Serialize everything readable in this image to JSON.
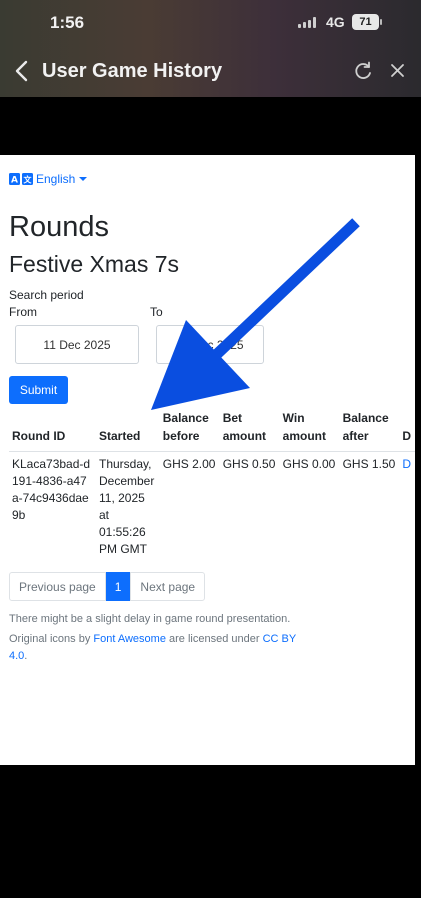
{
  "status": {
    "time": "1:56",
    "network": "4G",
    "battery": "71"
  },
  "header": {
    "title": "User Game History"
  },
  "language": {
    "label": "English"
  },
  "page": {
    "heading": "Rounds",
    "game_name": "Festive Xmas 7s"
  },
  "search": {
    "period_label": "Search period",
    "from_label": "From",
    "to_label": "To",
    "from_value": "11 Dec 2025",
    "to_value": "11 Dec 2025",
    "submit_label": "Submit"
  },
  "table": {
    "headers": [
      "Round ID",
      "Started",
      "Balance before",
      "Bet amount",
      "Win amount",
      "Balance after",
      "D"
    ],
    "rows": [
      {
        "round_id": "KLaca73bad-d191-4836-a47a-74c9436dae9b",
        "started": "Thursday, December 11, 2025 at 01:55:26 PM GMT",
        "balance_before": "GHS 2.00",
        "bet_amount": "GHS 0.50",
        "win_amount": "GHS 0.00",
        "balance_after": "GHS 1.50",
        "details": "D"
      }
    ]
  },
  "pagination": {
    "previous": "Previous page",
    "current": "1",
    "next": "Next page"
  },
  "footer": {
    "note": "There might be a slight delay in game round presentation.",
    "credit_prefix": "Original icons by",
    "credit_link": "Font Awesome",
    "credit_middle": "are licensed under",
    "license_link": "CC BY 4.0",
    "credit_suffix": "."
  },
  "colors": {
    "accent": "#0d6efd",
    "annotation_arrow": "#0a4ee0"
  }
}
